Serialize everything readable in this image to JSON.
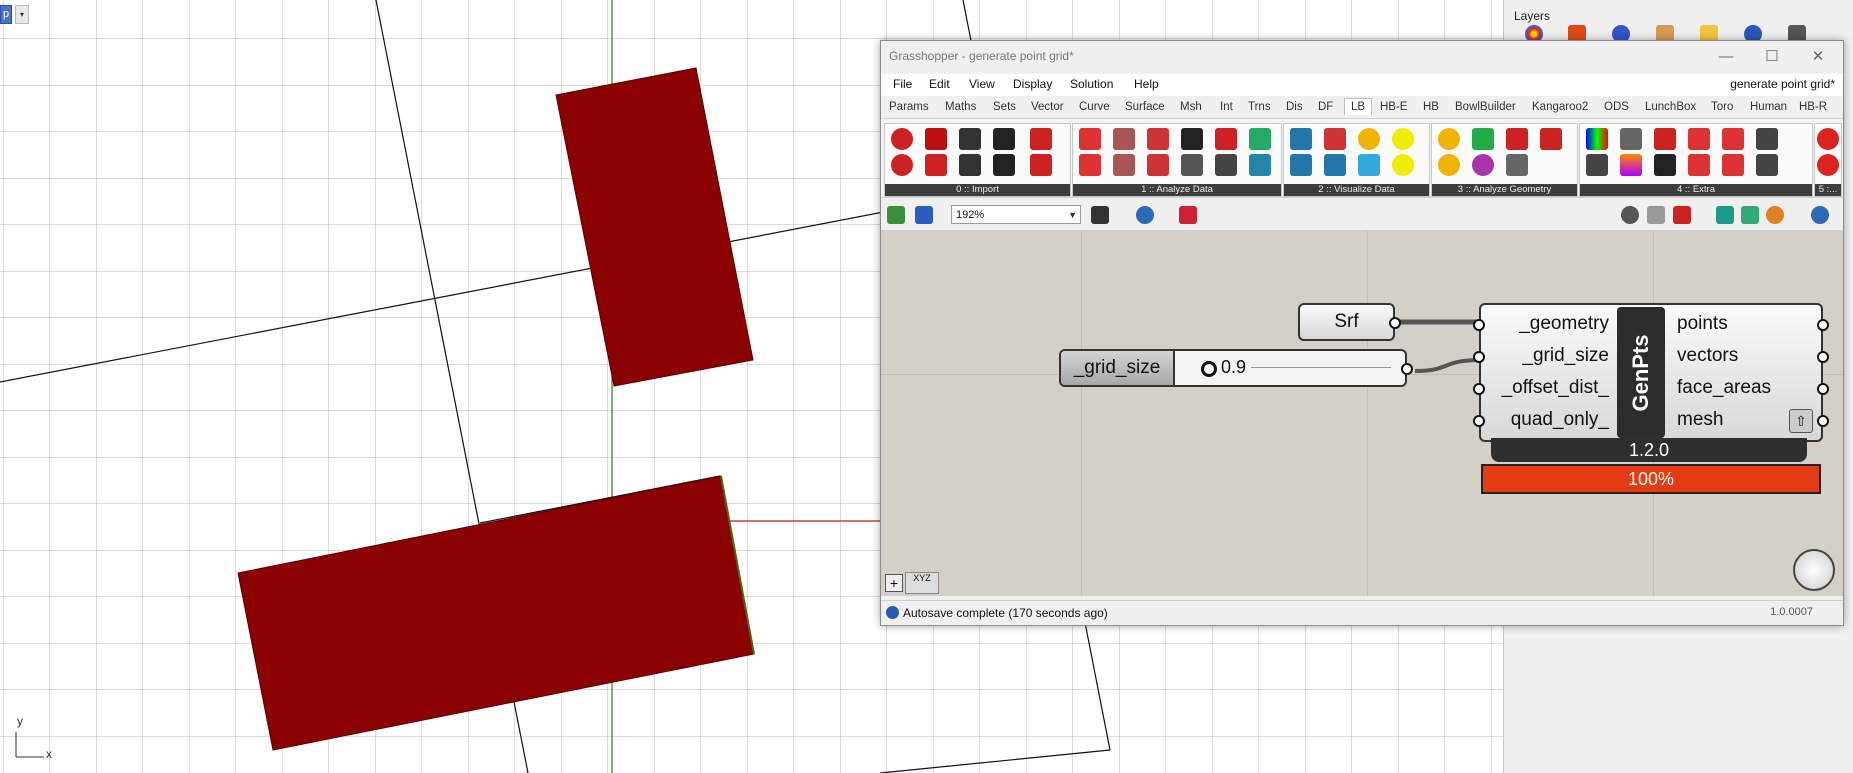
{
  "viewport": {
    "label": "p",
    "dropdown": "▾",
    "axis_y": "y",
    "axis_x": "x"
  },
  "layers_panel": {
    "title": "Layers"
  },
  "grasshopper": {
    "title": "Grasshopper - generate point grid*",
    "window_buttons": [
      "—",
      "☐",
      "✕"
    ],
    "menu": [
      "File",
      "Edit",
      "View",
      "Display",
      "Solution",
      "Help"
    ],
    "document_name": "generate point grid*",
    "tabs": [
      "Params",
      "Maths",
      "Sets",
      "Vector",
      "Curve",
      "Surface",
      "Msh",
      "Int",
      "Trns",
      "Dis",
      "DF",
      "LB",
      "HB-E",
      "HB",
      "BowlBuilder",
      "Kangaroo2",
      "ODS",
      "LunchBox",
      "Toro",
      "Human",
      "HB-R"
    ],
    "active_tab": "LB",
    "ribbon_groups": [
      "0 :: Import",
      "1 :: Analyze Data",
      "2 :: Visualize Data",
      "3 :: Analyze Geometry",
      "4 :: Extra",
      "5 :..."
    ],
    "zoom": "192%",
    "srf_label": "Srf",
    "slider": {
      "name": "_grid_size",
      "value": "0.9"
    },
    "genpts": {
      "name": "GenPts",
      "inputs": [
        "_geometry",
        "_grid_size",
        "_offset_dist_",
        "quad_only_"
      ],
      "outputs": [
        "points",
        "vectors",
        "face_areas",
        "mesh"
      ],
      "version": "1.2.0",
      "progress": "100%"
    },
    "status_text": "Autosave complete (170 seconds ago)",
    "version": "1.0.0007",
    "xyz": "XYZ"
  },
  "colors": {
    "surface_red": "#8b0000",
    "progress_red": "#e53b12",
    "grid_line": "#b8b8b8"
  }
}
